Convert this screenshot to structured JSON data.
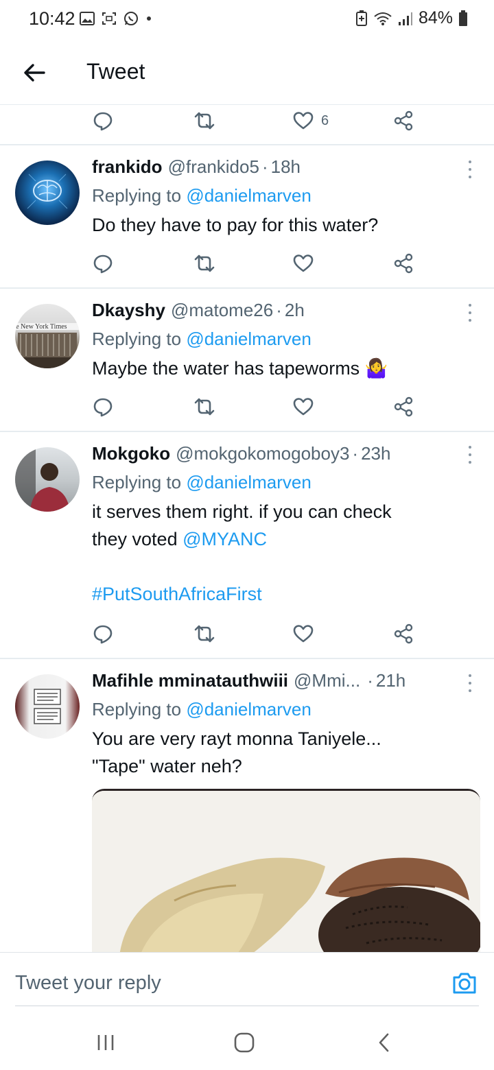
{
  "status_bar": {
    "time": "10:42",
    "battery": "84%",
    "notification_icons": [
      "gallery-icon",
      "screenshot-icon",
      "whatsapp-icon",
      "dot-icon"
    ],
    "system_icons": [
      "battery-saver-icon",
      "wifi-icon",
      "signal-icon",
      "battery-icon"
    ]
  },
  "header": {
    "title": "Tweet"
  },
  "top_actions": {
    "like_count": "6"
  },
  "tweets": [
    {
      "name": "frankido",
      "handle": "@frankido5",
      "separator": "·",
      "time": "18h",
      "replying_prefix": "Replying to",
      "replying_to": "@danielmarven",
      "text": "Do they have to pay for this water?"
    },
    {
      "name": "Dkayshy",
      "handle": "@matome26",
      "separator": "·",
      "time": "2h",
      "replying_prefix": "Replying to",
      "replying_to": "@danielmarven",
      "text": "Maybe the water has tapeworms",
      "emoji": "🤷‍♀️",
      "avatar_text": "The New York Times"
    },
    {
      "name": "Mokgoko",
      "handle": "@mokgokomogoboy3",
      "separator": "·",
      "time": "23h",
      "replying_prefix": "Replying to",
      "replying_to": "@danielmarven",
      "text_line1": "it serves them right. if you can check",
      "text_line2_prefix": "they voted",
      "text_line2_mention": "@MYANC",
      "hashtag": "#PutSouthAfricaFirst"
    },
    {
      "name": "Mafihle mminatauthwiii",
      "handle": "@Mmi...",
      "separator": "·",
      "time": "21h",
      "replying_prefix": "Replying to",
      "replying_to": "@danielmarven",
      "text_line1": "You are very rayt monna Taniyele...",
      "text_line2": "\"Tape\" water neh?"
    }
  ],
  "reply_bar": {
    "placeholder": "Tweet your reply"
  },
  "colors": {
    "accent": "#1d9bf0",
    "text": "#0f1419",
    "secondary": "#536471",
    "divider": "#e6ecf0"
  }
}
